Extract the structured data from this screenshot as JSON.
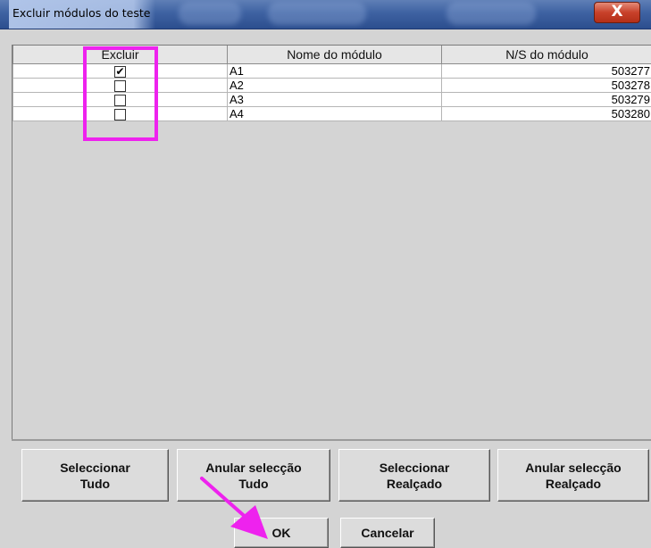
{
  "window": {
    "title": "Excluir módulos do teste",
    "close_label": "X"
  },
  "table": {
    "columns": [
      "Excluir",
      "Nome do módulo",
      "N/S do módulo"
    ],
    "rows": [
      {
        "checked": true,
        "check_glyph": "✔",
        "name": "A1",
        "serial": "503277"
      },
      {
        "checked": false,
        "check_glyph": "",
        "name": "A2",
        "serial": "503278"
      },
      {
        "checked": false,
        "check_glyph": "",
        "name": "A3",
        "serial": "503279"
      },
      {
        "checked": false,
        "check_glyph": "",
        "name": "A4",
        "serial": "503280"
      }
    ]
  },
  "buttons": {
    "select_all": "Seleccionar\nTudo",
    "deselect_all": "Anular selecção\nTudo",
    "select_highlighted": "Seleccionar\nRealçado",
    "deselect_highlighted": "Anular selecção\nRealçado",
    "ok": "OK",
    "cancel": "Cancelar"
  },
  "colors": {
    "annotation": "#ee22ee",
    "close_button": "#c8412a",
    "titlebar": "#3e62a2"
  }
}
